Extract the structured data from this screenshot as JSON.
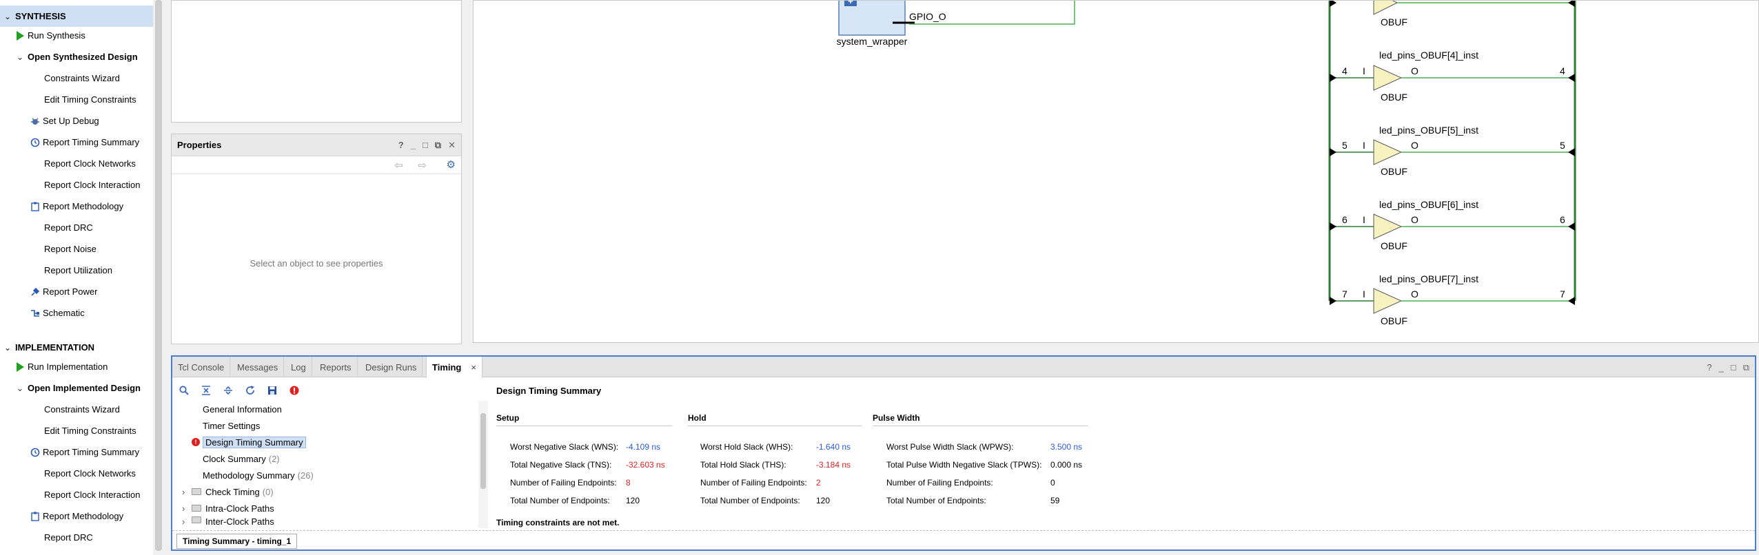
{
  "flow_navigator": {
    "synthesis": {
      "title": "SYNTHESIS",
      "run": "Run Synthesis",
      "open_design": "Open Synthesized Design",
      "items": [
        "Constraints Wizard",
        "Edit Timing Constraints",
        "Set Up Debug",
        "Report Timing Summary",
        "Report Clock Networks",
        "Report Clock Interaction",
        "Report Methodology",
        "Report DRC",
        "Report Noise",
        "Report Utilization",
        "Report Power",
        "Schematic"
      ]
    },
    "implementation": {
      "title": "IMPLEMENTATION",
      "run": "Run Implementation",
      "open_design": "Open Implemented Design",
      "items": [
        "Constraints Wizard",
        "Edit Timing Constraints",
        "Report Timing Summary",
        "Report Clock Networks",
        "Report Clock Interaction",
        "Report Methodology",
        "Report DRC"
      ]
    }
  },
  "properties": {
    "title": "Properties",
    "header_icons": [
      "?",
      "_",
      "□",
      "⧉",
      "✕"
    ],
    "empty_hint": "Select an object to see properties"
  },
  "schematic": {
    "block_label": "system_wrapper",
    "port_label": "GPIO_O",
    "buffers": [
      {
        "inst": "",
        "type": "OBUF",
        "in_pin": "",
        "out_pin": "",
        "net_in": "",
        "net_out": ""
      },
      {
        "inst": "led_pins_OBUF[4]_inst",
        "type": "OBUF",
        "in_pin": "I",
        "out_pin": "O",
        "net_in": "4",
        "net_out": "4"
      },
      {
        "inst": "led_pins_OBUF[5]_inst",
        "type": "OBUF",
        "in_pin": "I",
        "out_pin": "O",
        "net_in": "5",
        "net_out": "5"
      },
      {
        "inst": "led_pins_OBUF[6]_inst",
        "type": "OBUF",
        "in_pin": "I",
        "out_pin": "O",
        "net_in": "6",
        "net_out": "6"
      },
      {
        "inst": "led_pins_OBUF[7]_inst",
        "type": "OBUF",
        "in_pin": "I",
        "out_pin": "O",
        "net_in": "7",
        "net_out": "7"
      }
    ]
  },
  "bottom_panel": {
    "tabs": [
      "Tcl Console",
      "Messages",
      "Log",
      "Reports",
      "Design Runs",
      "Timing"
    ],
    "active_tab": "Timing",
    "close_glyph": "×",
    "header_icons": [
      "?",
      "_",
      "□",
      "⧉"
    ],
    "toolbar_icons": [
      "search-icon",
      "collapse-all-icon",
      "expand-all-icon",
      "refresh-icon",
      "save-icon",
      "error-icon"
    ],
    "tree": [
      {
        "label": "General Information",
        "count": ""
      },
      {
        "label": "Timer Settings",
        "count": ""
      },
      {
        "label": "Design Timing Summary",
        "count": ""
      },
      {
        "label": "Clock Summary",
        "count": "(2)"
      },
      {
        "label": "Methodology Summary",
        "count": "(26)"
      },
      {
        "label": "Check Timing",
        "count": "(0)"
      },
      {
        "label": "Intra-Clock Paths",
        "count": ""
      },
      {
        "label": "Inter-Clock Paths",
        "count": ""
      }
    ],
    "summary": {
      "title": "Design Timing Summary",
      "setup": {
        "title": "Setup",
        "rows": [
          {
            "label": "Worst Negative Slack (WNS):",
            "value": "-4.109 ns",
            "color": "#2a5ad8"
          },
          {
            "label": "Total Negative Slack (TNS):",
            "value": "-32.603 ns",
            "color": "#e02020"
          },
          {
            "label": "Number of Failing Endpoints:",
            "value": "8",
            "color": "#e02020"
          },
          {
            "label": "Total Number of Endpoints:",
            "value": "120",
            "color": "#000000"
          }
        ]
      },
      "hold": {
        "title": "Hold",
        "rows": [
          {
            "label": "Worst Hold Slack (WHS):",
            "value": "-1.640 ns",
            "color": "#2a5ad8"
          },
          {
            "label": "Total Hold Slack (THS):",
            "value": "-3.184 ns",
            "color": "#e02020"
          },
          {
            "label": "Number of Failing Endpoints:",
            "value": "2",
            "color": "#e02020"
          },
          {
            "label": "Total Number of Endpoints:",
            "value": "120",
            "color": "#000000"
          }
        ]
      },
      "pulse": {
        "title": "Pulse Width",
        "rows": [
          {
            "label": "Worst Pulse Width Slack (WPWS):",
            "value": "3.500 ns",
            "color": "#2a5ad8"
          },
          {
            "label": "Total Pulse Width Negative Slack (TPWS):",
            "value": "0.000 ns",
            "color": "#000000"
          },
          {
            "label": "Number of Failing Endpoints:",
            "value": "0",
            "color": "#000000"
          },
          {
            "label": "Total Number of Endpoints:",
            "value": "59",
            "color": "#000000"
          }
        ]
      },
      "status": "Timing constraints are not met."
    },
    "result_tab": "Timing Summary - timing_1"
  }
}
